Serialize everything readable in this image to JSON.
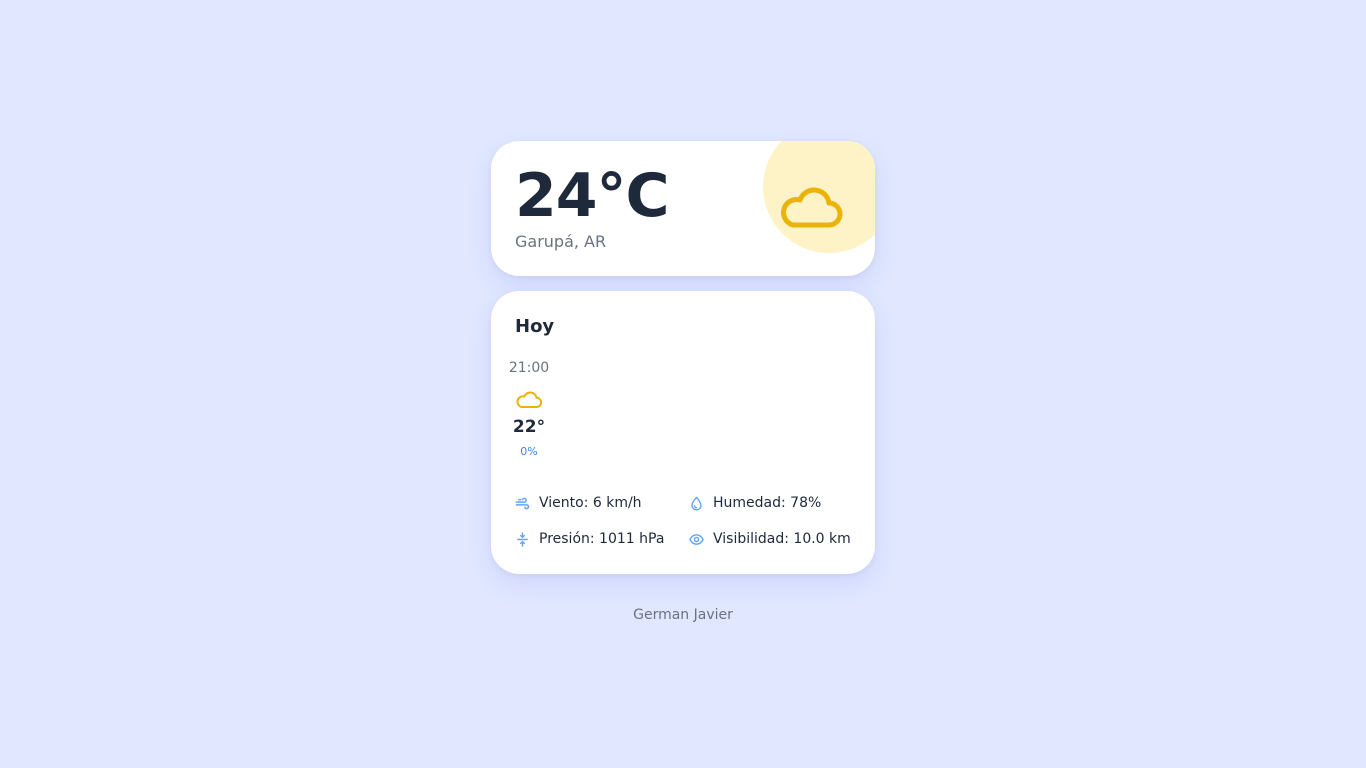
{
  "current": {
    "temperature": "24°C",
    "location": "Garupá, AR",
    "icon": "cloud-icon"
  },
  "today": {
    "title": "Hoy",
    "hourly": [
      {
        "time": "21:00",
        "icon": "cloud-icon",
        "temp": "22°",
        "rain": "0%"
      }
    ]
  },
  "stats": {
    "wind": "Viento: 6 km/h",
    "humidity": "Humedad: 78%",
    "pressure": "Presión: 1011 hPa",
    "visibility": "Visibilidad: 10.0 km"
  },
  "footer": {
    "author": "German Javier"
  },
  "colors": {
    "background": "#e0e7ff",
    "card": "#ffffff",
    "accent_icon": "#eab308",
    "sun_blob": "#fef3c7",
    "stat_icon": "#60a5fa",
    "rain_text": "#3b82f6"
  }
}
